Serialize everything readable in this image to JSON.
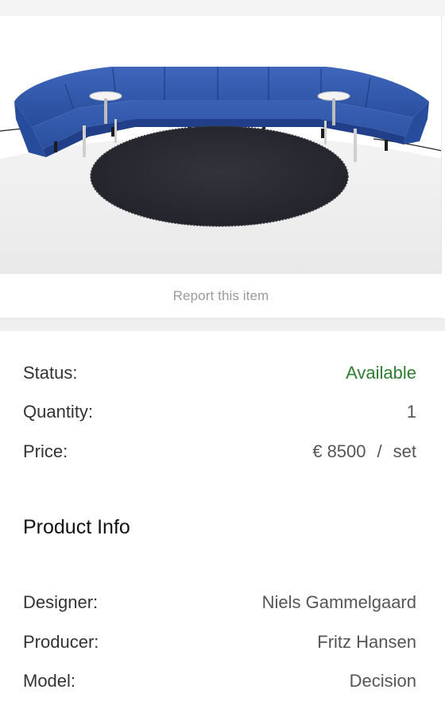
{
  "report": {
    "label": "Report this item"
  },
  "image": {
    "alt": "Blue curved modular sofa with round dark rug"
  },
  "details": {
    "status_label": "Status:",
    "status_value": "Available",
    "quantity_label": "Quantity:",
    "quantity_value": "1",
    "price_label": "Price:",
    "price_amount": "€ 8500",
    "price_sep": "/",
    "price_unit": "set"
  },
  "product_info": {
    "title": "Product Info",
    "designer_label": "Designer:",
    "designer_value": "Niels Gammelgaard",
    "producer_label": "Producer:",
    "producer_value": "Fritz Hansen",
    "model_label": "Model:",
    "model_value": "Decision"
  },
  "colors": {
    "status_available": "#2e7d32",
    "sofa_blue": "#2f56a8",
    "rug": "#2b2c33"
  }
}
